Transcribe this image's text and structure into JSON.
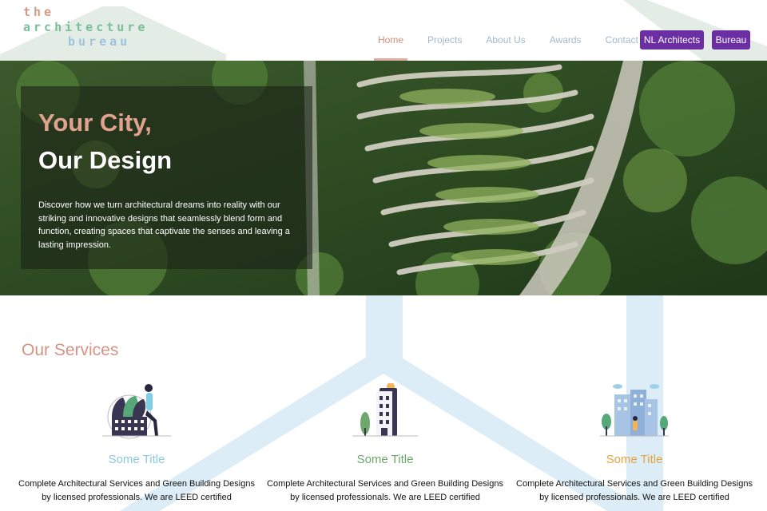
{
  "logo": {
    "line1": "the",
    "line2": "architecture",
    "line3": "bureau"
  },
  "nav": {
    "links": [
      "Home",
      "Projects",
      "About Us",
      "Awards",
      "Contact Us"
    ],
    "active": "Home",
    "buttons": [
      "NL Architects",
      "Bureau"
    ]
  },
  "hero": {
    "title_line1": "Your City,",
    "title_line2": "Our Design",
    "description": "Discover how we turn architectural dreams into reality with our striking and innovative designs that seamlessly blend form and function, creating spaces that captivate the senses and leaving a lasting impression."
  },
  "services": {
    "heading": "Our Services",
    "cards": [
      {
        "title": "Some Title",
        "title_color": "#8cc8e2",
        "text": "Complete Architectural Services and Green Building Designs by licensed professionals. We are LEED certified",
        "illustration": "building-dome-person-illustration"
      },
      {
        "title": "Some Title",
        "title_color": "#6fa76c",
        "text": "Complete Architectural Services and Green Building Designs by licensed professionals. We are LEED certified",
        "illustration": "tower-building-illustration"
      },
      {
        "title": "Some Title",
        "title_color": "#e3a542",
        "text": "Complete Architectural Services and Green Building Designs by licensed professionals. We are LEED certified",
        "illustration": "city-block-illustration"
      }
    ]
  },
  "colors": {
    "accent_purple": "#6b2fa3",
    "accent_salmon": "#d49484",
    "nav_muted": "#a3b8cc"
  }
}
